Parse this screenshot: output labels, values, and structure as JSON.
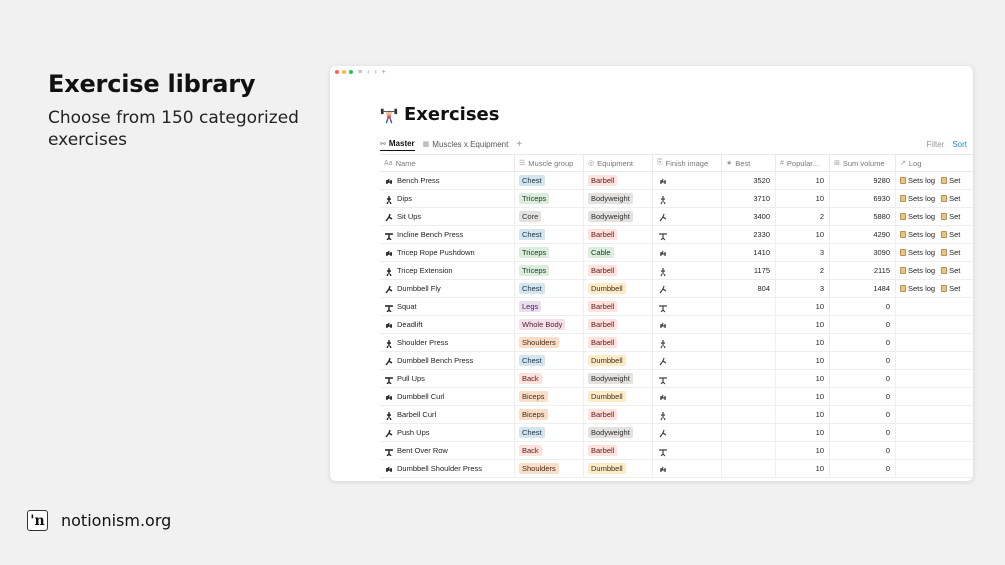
{
  "slide": {
    "headline": "Exercise library",
    "subline": "Choose from 150 categorized exercises"
  },
  "brand": {
    "logo_text": "'n",
    "site": "notionism.org"
  },
  "window": {
    "title": "Exercises",
    "title_icon": "weightlifter-icon",
    "tabs": [
      {
        "label": "Master",
        "icon": "board-icon",
        "active": true
      },
      {
        "label": "Muscles x Equipment",
        "icon": "table-icon",
        "active": false
      }
    ],
    "add_tab": "+",
    "filter_label": "Filter",
    "sort_label": "Sort",
    "columns": [
      {
        "key": "name",
        "label": "Name",
        "icon": "Aa"
      },
      {
        "key": "muscle",
        "label": "Muscle group",
        "icon": "☰"
      },
      {
        "key": "equipment",
        "label": "Equipment",
        "icon": "◎"
      },
      {
        "key": "image",
        "label": "Finish image",
        "icon": "⎘"
      },
      {
        "key": "best",
        "label": "Best",
        "icon": "★"
      },
      {
        "key": "popular",
        "label": "Popular...",
        "icon": "#"
      },
      {
        "key": "sum",
        "label": "Sum volume",
        "icon": "⊞"
      },
      {
        "key": "log",
        "label": "Log",
        "icon": "↗"
      }
    ],
    "log_label": "Sets log",
    "log_label_cut": "Set",
    "colors": {
      "Chest": {
        "bg": "#d3e5ef",
        "fg": "#183347"
      },
      "Triceps": {
        "bg": "#dbeddb",
        "fg": "#1c3829"
      },
      "Core": {
        "bg": "#e3e2e0",
        "fg": "#32302c"
      },
      "Legs": {
        "bg": "#e8deee",
        "fg": "#412454"
      },
      "Whole Body": {
        "bg": "#f5e0e9",
        "fg": "#4c2337"
      },
      "Shoulders": {
        "bg": "#fadec9",
        "fg": "#49290e"
      },
      "Back": {
        "bg": "#ffe2dd",
        "fg": "#5d1715"
      },
      "Biceps": {
        "bg": "#fadec9",
        "fg": "#49290e"
      },
      "Barbell": {
        "bg": "#ffe2dd",
        "fg": "#5d1715"
      },
      "Bodyweight": {
        "bg": "#e3e2e0",
        "fg": "#32302c"
      },
      "Cable": {
        "bg": "#dbeddb",
        "fg": "#1c3829"
      },
      "Dumbbell": {
        "bg": "#fdecc8",
        "fg": "#402c1b"
      }
    },
    "rows": [
      {
        "name": "Bench Press",
        "muscle": "Chest",
        "equipment": "Barbell",
        "best": "3520",
        "popular": "10",
        "sum": "9280",
        "log": true
      },
      {
        "name": "Dips",
        "muscle": "Triceps",
        "equipment": "Bodyweight",
        "best": "3710",
        "popular": "10",
        "sum": "6930",
        "log": true
      },
      {
        "name": "Sit Ups",
        "muscle": "Core",
        "equipment": "Bodyweight",
        "best": "3400",
        "popular": "2",
        "sum": "5880",
        "log": true
      },
      {
        "name": "Incline Bench Press",
        "muscle": "Chest",
        "equipment": "Barbell",
        "best": "2330",
        "popular": "10",
        "sum": "4290",
        "log": true
      },
      {
        "name": "Tricep Rope Pushdown",
        "muscle": "Triceps",
        "equipment": "Cable",
        "best": "1410",
        "popular": "3",
        "sum": "3090",
        "log": true
      },
      {
        "name": "Tricep Extension",
        "muscle": "Triceps",
        "equipment": "Barbell",
        "best": "1175",
        "popular": "2",
        "sum": "2115",
        "log": true
      },
      {
        "name": "Dumbbell Fly",
        "muscle": "Chest",
        "equipment": "Dumbbell",
        "best": "804",
        "popular": "3",
        "sum": "1484",
        "log": true
      },
      {
        "name": "Squat",
        "muscle": "Legs",
        "equipment": "Barbell",
        "best": "",
        "popular": "10",
        "sum": "0",
        "log": false
      },
      {
        "name": "Deadlift",
        "muscle": "Whole Body",
        "equipment": "Barbell",
        "best": "",
        "popular": "10",
        "sum": "0",
        "log": false
      },
      {
        "name": "Shoulder Press",
        "muscle": "Shoulders",
        "equipment": "Barbell",
        "best": "",
        "popular": "10",
        "sum": "0",
        "log": false
      },
      {
        "name": "Dumbbell Bench Press",
        "muscle": "Chest",
        "equipment": "Dumbbell",
        "best": "",
        "popular": "10",
        "sum": "0",
        "log": false
      },
      {
        "name": "Pull Ups",
        "muscle": "Back",
        "equipment": "Bodyweight",
        "best": "",
        "popular": "10",
        "sum": "0",
        "log": false
      },
      {
        "name": "Dumbbell Curl",
        "muscle": "Biceps",
        "equipment": "Dumbbell",
        "best": "",
        "popular": "10",
        "sum": "0",
        "log": false
      },
      {
        "name": "Barbell Curl",
        "muscle": "Biceps",
        "equipment": "Barbell",
        "best": "",
        "popular": "10",
        "sum": "0",
        "log": false
      },
      {
        "name": "Push Ups",
        "muscle": "Chest",
        "equipment": "Bodyweight",
        "best": "",
        "popular": "10",
        "sum": "0",
        "log": false
      },
      {
        "name": "Bent Over Row",
        "muscle": "Back",
        "equipment": "Barbell",
        "best": "",
        "popular": "10",
        "sum": "0",
        "log": false
      },
      {
        "name": "Dumbbell Shoulder Press",
        "muscle": "Shoulders",
        "equipment": "Dumbbell",
        "best": "",
        "popular": "10",
        "sum": "0",
        "log": false
      }
    ]
  }
}
